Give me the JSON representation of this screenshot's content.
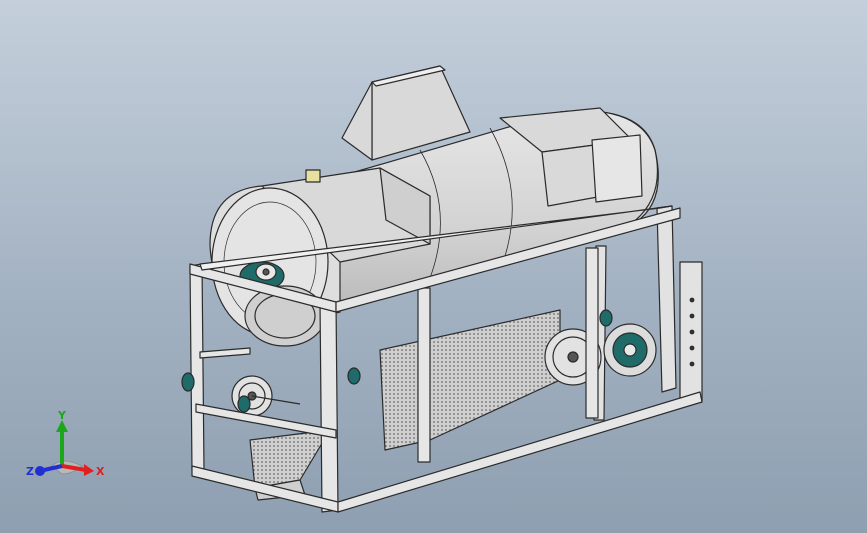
{
  "viewport": {
    "background_top": "#c4cfdb",
    "background_bottom": "#8e9fb1"
  },
  "model": {
    "metal_color": "#d9d9d9",
    "frame_color": "#e2e2e2",
    "edge_color": "#2b2b2b",
    "bearing_color": "#1f6b6a",
    "mesh_color": "#bdbdbd",
    "cap_color": "#e8e0a0"
  },
  "triad": {
    "x_label": "X",
    "y_label": "Y",
    "z_label": "Z",
    "x_color": "#e02020",
    "y_color": "#1aa81a",
    "z_color": "#2030d0"
  }
}
